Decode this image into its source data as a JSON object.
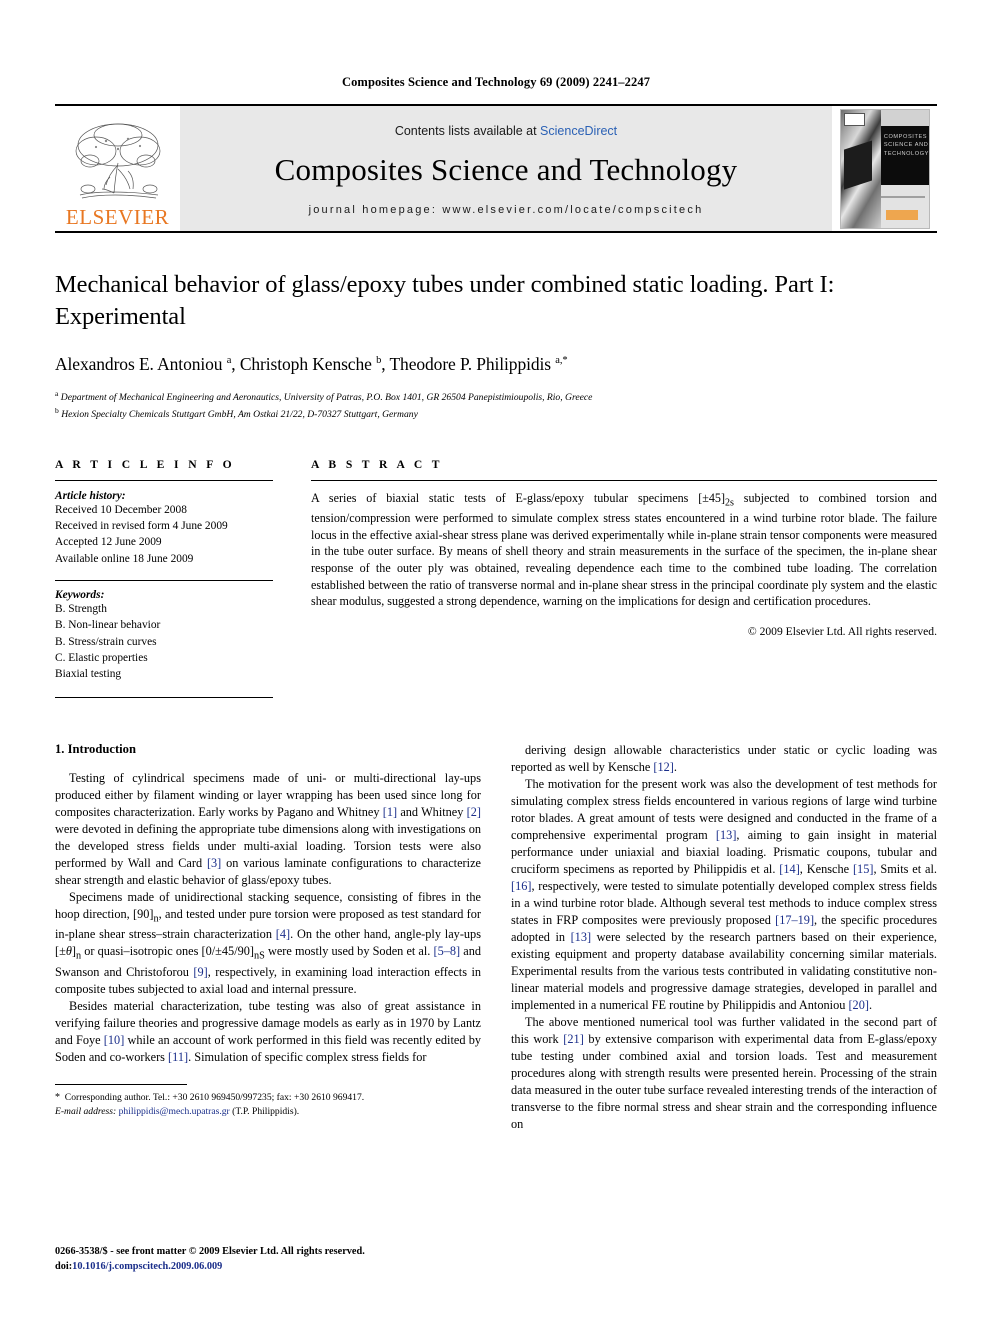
{
  "running_head": "Composites Science and Technology 69 (2009) 2241–2247",
  "masthead": {
    "contents_prefix": "Contents lists available at ",
    "sciencedirect": "ScienceDirect",
    "journal_title": "Composites Science and Technology",
    "homepage": "journal homepage: www.elsevier.com/locate/compscitech",
    "publisher": "ELSEVIER",
    "cover_title": "COMPOSITES SCIENCE AND TECHNOLOGY",
    "link_color": "#2b61b5",
    "publisher_color": "#E87722"
  },
  "article": {
    "title": "Mechanical behavior of glass/epoxy tubes under combined static loading. Part I: Experimental",
    "authors_html": "Alexandros E. Antoniou <sup>a</sup>, Christoph Kensche <sup>b</sup>, Theodore P. Philippidis <sup>a,</sup><sup>*</sup>",
    "affiliation_a": "Department of Mechanical Engineering and Aeronautics, University of Patras, P.O. Box 1401, GR 26504 Panepistimioupolis, Rio, Greece",
    "affiliation_b": "Hexion Specialty Chemicals Stuttgart GmbH, Am Ostkai 21/22, D-70327 Stuttgart, Germany"
  },
  "info": {
    "heading": "A R T I C L E   I N F O",
    "history_label": "Article history:",
    "history": [
      "Received 10 December 2008",
      "Received in revised form 4 June 2009",
      "Accepted 12 June 2009",
      "Available online 18 June 2009"
    ],
    "keywords_label": "Keywords:",
    "keywords": [
      "B. Strength",
      "B. Non-linear behavior",
      "B. Stress/strain curves",
      "C. Elastic properties",
      "Biaxial testing"
    ]
  },
  "abstract": {
    "heading": "A B S T R A C T",
    "text_html": "A series of biaxial static tests of E-glass/epoxy tubular specimens [±45]<sub>2s</sub> subjected to combined torsion and tension/compression were performed to simulate complex stress states encountered in a wind turbine rotor blade. The failure locus in the effective axial-shear stress plane was derived experimentally while in-plane strain tensor components were measured in the tube outer surface. By means of shell theory and strain measurements in the surface of the specimen, the in-plane shear response of the outer ply was obtained, revealing dependence each time to the combined tube loading. The correlation established between the ratio of transverse normal and in-plane shear stress in the principal coordinate ply system and the elastic shear modulus, suggested a strong dependence, warning on the implications for design and certification procedures.",
    "copyright": "© 2009 Elsevier Ltd. All rights reserved."
  },
  "body": {
    "section_heading": "1. Introduction",
    "left_paragraphs_html": [
      "Testing of cylindrical specimens made of uni- or multi-directional lay-ups produced either by filament winding or layer wrapping has been used since long for composites characterization. Early works by Pagano and Whitney <span class=\"ref\">[1]</span> and Whitney <span class=\"ref\">[2]</span> were devoted in defining the appropriate tube dimensions along with investigations on the developed stress fields under multi-axial loading. Torsion tests were also performed by Wall and Card <span class=\"ref\">[3]</span> on various laminate configurations to characterize shear strength and elastic behavior of glass/epoxy tubes.",
      "Specimens made of unidirectional stacking sequence, consisting of fibres in the hoop direction, [90]<sub>n</sub>, and tested under pure torsion were proposed as test standard for in-plane shear stress–strain characterization <span class=\"ref\">[4]</span>. On the other hand, angle-ply lay-ups [±<i>θ</i>]<sub>n</sub> or quasi–isotropic ones [0/±45/90]<sub>nS</sub> were mostly used by Soden et al. <span class=\"ref\">[5–8]</span> and Swanson and Christoforou <span class=\"ref\">[9]</span>, respectively, in examining load interaction effects in composite tubes subjected to axial load and internal pressure.",
      "Besides material characterization, tube testing was also of great assistance in verifying failure theories and progressive damage models as early as in 1970 by Lantz and Foye <span class=\"ref\">[10]</span> while an account of work performed in this field was recently edited by Soden and co-workers <span class=\"ref\">[11]</span>. Simulation of specific complex stress fields for"
    ],
    "right_paragraphs_html": [
      "deriving design allowable characteristics under static or cyclic loading was reported as well by Kensche <span class=\"ref\">[12]</span>.",
      "The motivation for the present work was also the development of test methods for simulating complex stress fields encountered in various regions of large wind turbine rotor blades. A great amount of tests were designed and conducted in the frame of a comprehensive experimental program <span class=\"ref\">[13]</span>, aiming to gain insight in material performance under uniaxial and biaxial loading. Prismatic coupons, tubular and cruciform specimens as reported by Philippidis et al. <span class=\"ref\">[14]</span>, Kensche <span class=\"ref\">[15]</span>, Smits et al. <span class=\"ref\">[16]</span>, respectively, were tested to simulate potentially developed complex stress fields in a wind turbine rotor blade. Although several test methods to induce complex stress states in FRP composites were previously proposed <span class=\"ref\">[17–19]</span>, the specific procedures adopted in <span class=\"ref\">[13]</span> were selected by the research partners based on their experience, existing equipment and property database availability concerning similar materials. Experimental results from the various tests contributed in validating constitutive non-linear material models and progressive damage strategies, developed in parallel and implemented in a numerical FE routine by Philippidis and Antoniou <span class=\"ref\">[20]</span>.",
      "The above mentioned numerical tool was further validated in the second part of this work <span class=\"ref\">[21]</span> by extensive comparison with experimental data from E-glass/epoxy tube testing under combined axial and torsion loads. Test and measurement procedures along with strength results were presented herein. Processing of the strain data measured in the outer tube surface revealed interesting trends of the interaction of transverse to the fibre normal stress and shear strain and the corresponding influence on"
    ]
  },
  "footnote": {
    "corresponding_html": "<span class=\"star\">*</span> &nbsp;Corresponding author. Tel.: +30 2610 969450/997235; fax: +30 2610 969417.",
    "email_label": "E-mail address:",
    "email": "philippidis@mech.upatras.gr",
    "email_suffix": "(T.P. Philippidis)."
  },
  "footer": {
    "issn_line_html": "0266-3538/$ - see front matter © 2009 Elsevier Ltd. All rights reserved.",
    "doi_prefix": "doi:",
    "doi": "10.1016/j.compscitech.2009.06.009"
  }
}
